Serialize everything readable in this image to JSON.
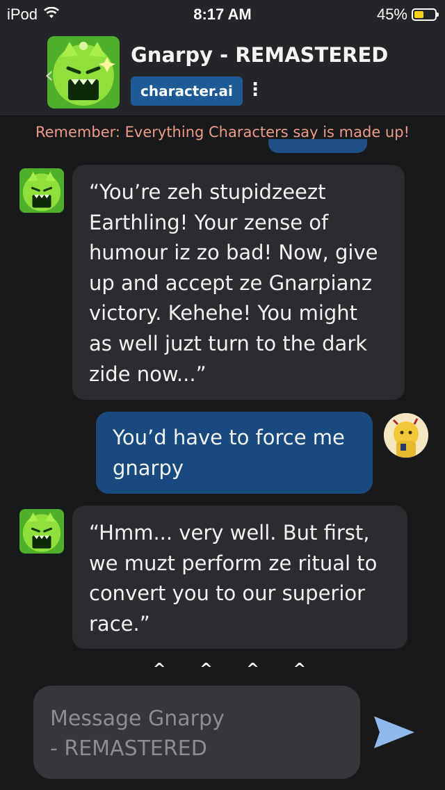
{
  "status_bar": {
    "device": "iPod",
    "time": "8:17 AM",
    "battery_percent": "45%",
    "battery_level": 0.45,
    "battery_color": "#f7d019"
  },
  "header": {
    "character_name": "Gnarpy - REMASTERED",
    "brand": "character.ai",
    "menu_icon": "kebab-menu-icon",
    "back_icon": "chevron-left-icon"
  },
  "disclaimer": "Remember: Everything Characters say is made up!",
  "messages": [
    {
      "sender": "character",
      "text": "“You’re zeh stupidzeezt\nEarthling! Your zense of\nhumour iz zo bad! Now, give\nup and accept ze Gnarpianz\nvictory. Kehehe! You might\nas well juzt turn to the dark\nzide now...”"
    },
    {
      "sender": "user",
      "text": "You’d have to force me\ngnarpy"
    },
    {
      "sender": "character",
      "text": "“Hmm... very well. But first,\nwe muzt perform ze ritual to\nconvert you to our superior\nrace.”"
    }
  ],
  "carets": [
    "^",
    "^",
    "^",
    "^"
  ],
  "composer": {
    "placeholder": "Message Gnarpy\n- REMASTERED",
    "send_icon": "send-icon"
  },
  "colors": {
    "background": "#18191b",
    "header": "#242528",
    "character_bubble": "#2b2c30",
    "user_bubble": "#184a80",
    "brand_badge": "#1d5a96",
    "disclaimer": "#ef9b86",
    "send": "#8fb9ec"
  }
}
